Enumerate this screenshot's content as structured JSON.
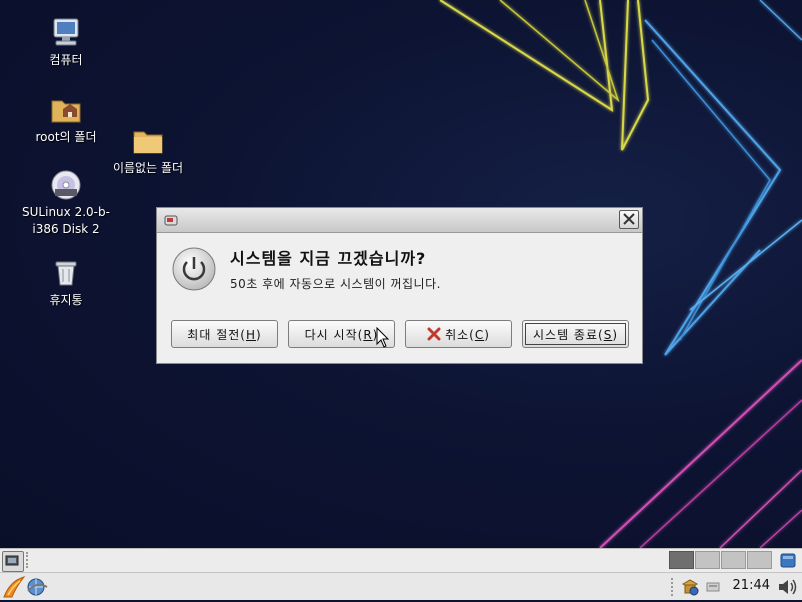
{
  "desktop": {
    "icons": [
      {
        "label": "컴퓨터",
        "icon": "computer-icon"
      },
      {
        "label": "root의 폴더",
        "icon": "home-folder-icon"
      },
      {
        "label": "이름없는 폴더",
        "icon": "folder-icon"
      },
      {
        "label": "SULinux 2.0-b-\ni386 Disk 2",
        "icon": "dvd-icon"
      },
      {
        "label": "휴지통",
        "icon": "trash-icon"
      }
    ]
  },
  "dialog": {
    "heading": "시스템을 지금 끄겠습니까?",
    "message": "50초 후에 자동으로 시스템이 꺼집니다.",
    "buttons": {
      "hibernate": {
        "label": "최대 절전(",
        "mnemonic": "H",
        "suffix": ")"
      },
      "restart": {
        "label": "다시 시작(",
        "mnemonic": "R",
        "suffix": ")"
      },
      "cancel": {
        "label": "취소(",
        "mnemonic": "C",
        "suffix": ")",
        "icon": "cancel-x-icon"
      },
      "shutdown": {
        "label": "시스템 종료(",
        "mnemonic": "S",
        "suffix": ")"
      }
    }
  },
  "panel": {
    "clock": "21:44",
    "workspaces": [
      {
        "active": true
      },
      {
        "active": false
      },
      {
        "active": false
      },
      {
        "active": false
      }
    ]
  },
  "colors": {
    "desktop_bg": "#0c1330",
    "accent_yellow": "#d8d84a",
    "accent_blue": "#4fa3e8",
    "accent_pink": "#d24fb5"
  }
}
